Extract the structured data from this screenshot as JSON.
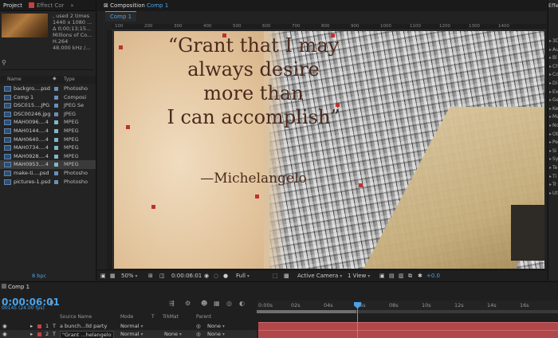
{
  "project": {
    "tab_label": "Project",
    "effect_tab_label": "Effect Cor",
    "info_lines": [
      ", used 2 times",
      "1440 x 1080 ...",
      "Δ 0;00;13;15...",
      "Millions of Co...",
      "H.264",
      "48.000 kHz /..."
    ],
    "search_placeholder": "",
    "col_name": "Name",
    "col_type": "Type",
    "files": [
      {
        "name": "backgro....psd",
        "type": "Photosho",
        "color": "#6a8fb8"
      },
      {
        "name": "Comp 1",
        "type": "Composi",
        "color": "#6a8fb8"
      },
      {
        "name": "DSC015....JPG",
        "type": "JPEG Se",
        "color": "#6a8fb8"
      },
      {
        "name": "DSC00246.jpg",
        "type": "JPEG",
        "color": "#6a8fb8"
      },
      {
        "name": "MAH0096....4",
        "type": "MPEG",
        "color": "#7fb8c9"
      },
      {
        "name": "MAH0144....4",
        "type": "MPEG",
        "color": "#7fb8c9"
      },
      {
        "name": "MAH0640....4",
        "type": "MPEG",
        "color": "#7fb8c9"
      },
      {
        "name": "MAH0734....4",
        "type": "MPEG",
        "color": "#7fb8c9"
      },
      {
        "name": "MAH0928....4",
        "type": "MPEG",
        "color": "#7fb8c9"
      },
      {
        "name": "MAH0953....4",
        "type": "MPEG",
        "color": "#7fb8c9"
      },
      {
        "name": "make-ti....psd",
        "type": "Photosho",
        "color": "#6a8fb8"
      },
      {
        "name": "pictures-1.psd",
        "type": "Photosho",
        "color": "#6a8fb8"
      }
    ],
    "bpc": "8 bpc"
  },
  "composition": {
    "tab_prefix": "Composition",
    "tab_name": "Comp 1",
    "subtab": "Comp 1",
    "ruler_ticks": [
      "100",
      "200",
      "300",
      "400",
      "500",
      "600",
      "700",
      "800",
      "900",
      "1000",
      "1100",
      "1200",
      "1300",
      "1400"
    ],
    "quote_lines": [
      "“Grant that I may",
      "always desire",
      "more than",
      "I can accomplish”"
    ],
    "attribution": "—Michelangelo",
    "toolbar": {
      "zoom": "50%",
      "time": "0:00:06:01",
      "resolution": "Full",
      "camera": "Active Camera",
      "views": "1 View",
      "exposure": "+0.0"
    }
  },
  "effects": {
    "tab_label": "Effe",
    "items": [
      "3D",
      "Au",
      "Bl",
      "Ch",
      "Co",
      "Di",
      "Ex",
      "Ge",
      "Ke",
      "Ma",
      "No",
      "Ob",
      "Pe",
      "Si",
      "Sy",
      "Te",
      "Ti",
      "Tr",
      "Ut"
    ]
  },
  "timeline": {
    "tab_label": "Comp 1",
    "timecode": "0:00:06:01",
    "frames": "00145 (24.00 fps)",
    "headers": {
      "source": "Source Name",
      "mode": "Mode",
      "t": "T",
      "trkmat": "TrkMat",
      "parent": "Parent"
    },
    "layers": [
      {
        "num": "1",
        "name": "a bunch...lld party",
        "mode": "Normal",
        "trkmat": "",
        "parent": "None"
      },
      {
        "num": "2",
        "name": "\"Grant ...helangelo",
        "mode": "Normal",
        "trkmat": "None",
        "parent": "None"
      }
    ],
    "ruler": [
      "0:00s",
      "02s",
      "04s",
      "06s",
      "08s",
      "10s",
      "12s",
      "14s",
      "16s"
    ]
  }
}
